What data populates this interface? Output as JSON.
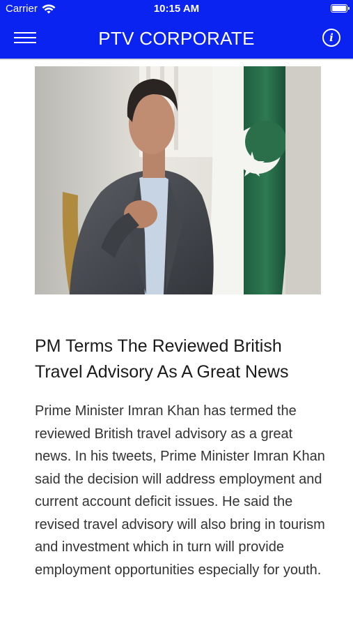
{
  "status_bar": {
    "carrier": "Carrier",
    "time": "10:15 AM",
    "battery_level": 1.0
  },
  "nav_bar": {
    "title": "PTV CORPORATE",
    "background_color": "#0b23f0",
    "left_icon": "menu-icon",
    "right_icon": "info-icon",
    "info_glyph": "i"
  },
  "article": {
    "image_alt": "Prime Minister Imran Khan speaking with Pakistan flag in background",
    "headline": "PM Terms The Reviewed British Travel Advisory As A Great News",
    "body": "Prime Minister Imran Khan has termed the reviewed British travel advisory as a great news. In his tweets, Prime Minister Imran Khan said the decision will address employment and current account deficit issues. He said the revised travel advisory will also bring in tourism and investment which in turn will provide employment opportunities especially for youth."
  }
}
